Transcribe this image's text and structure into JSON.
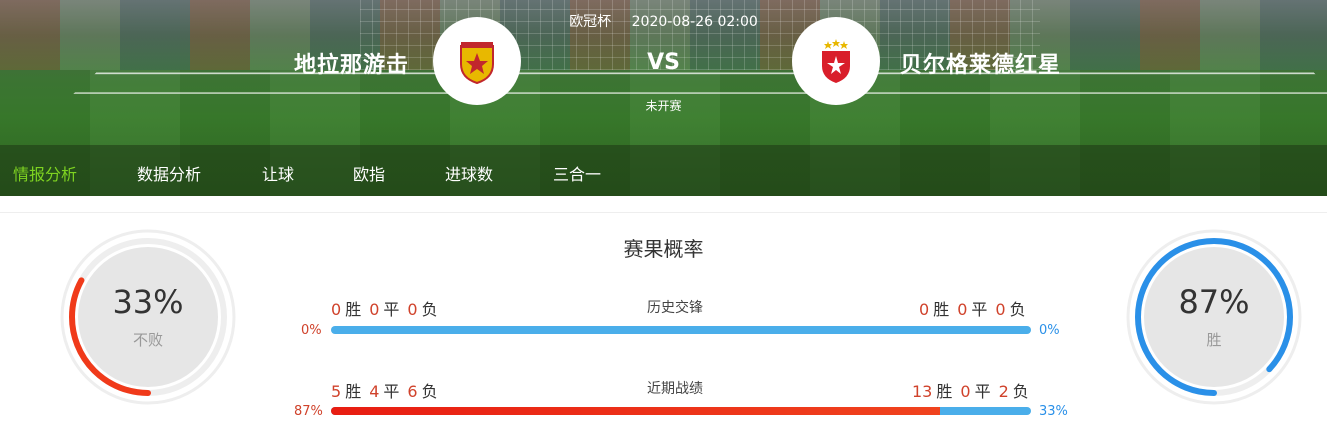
{
  "match": {
    "competition": "欧冠杯",
    "datetime": "2020-08-26 02:00",
    "home_team": "地拉那游击",
    "away_team": "贝尔格莱德红星",
    "vs": "VS",
    "status": "未开赛"
  },
  "nav": {
    "items": [
      {
        "label": "情报分析",
        "active": true
      },
      {
        "label": "数据分析",
        "active": false
      },
      {
        "label": "让球",
        "active": false
      },
      {
        "label": "欧指",
        "active": false
      },
      {
        "label": "进球数",
        "active": false
      },
      {
        "label": "三合一",
        "active": false
      }
    ]
  },
  "probability": {
    "title": "赛果概率",
    "home": {
      "value": "33%",
      "label": "不败",
      "fraction": 0.33,
      "color": "#f03a1a"
    },
    "away": {
      "value": "87%",
      "label": "胜",
      "fraction": 0.87,
      "color": "#2a90e8"
    }
  },
  "history": {
    "title": "历史交锋",
    "home": {
      "w": "0",
      "d": "0",
      "l": "0",
      "pct": "0%"
    },
    "away": {
      "w": "0",
      "d": "0",
      "l": "0",
      "pct": "0%"
    },
    "home_share": 0
  },
  "recent": {
    "title": "近期战绩",
    "home": {
      "w": "5",
      "d": "4",
      "l": "6",
      "pct": "87%"
    },
    "away": {
      "w": "13",
      "d": "0",
      "l": "2",
      "pct": "33%"
    },
    "home_share": 0.87
  },
  "labels": {
    "win": "胜",
    "draw": "平",
    "loss": "负"
  },
  "colors": {
    "nav_active": "#7ed321",
    "home_red": "#d0422b",
    "away_blue": "#2a90e8",
    "bar_blue": "#4aaeea"
  }
}
